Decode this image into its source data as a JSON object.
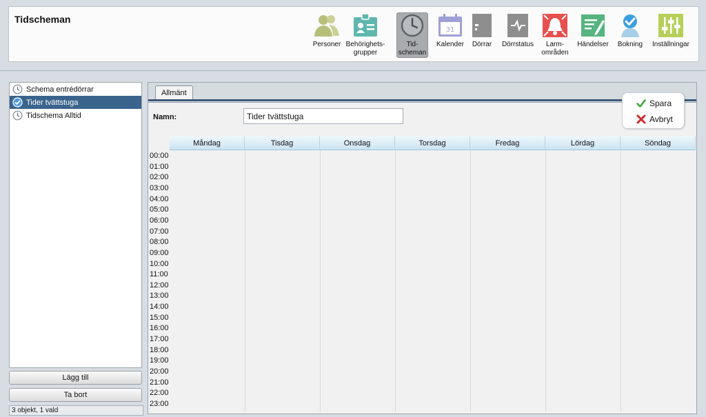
{
  "header": {
    "title": "Tidscheman",
    "tools": [
      {
        "name": "Personer",
        "lines": [
          "Personer",
          ""
        ],
        "icon": "persons-icon"
      },
      {
        "name": "Behörighetsgrupper",
        "lines": [
          "Behörighets-",
          "grupper"
        ],
        "icon": "id-card-icon"
      },
      {
        "name": "Tidscheman",
        "lines": [
          "Tid-",
          "scheman"
        ],
        "icon": "clock-icon",
        "active": true
      },
      {
        "name": "Kalender",
        "lines": [
          "Kalender",
          ""
        ],
        "icon": "calendar-icon"
      },
      {
        "name": "Dörrar",
        "lines": [
          "Dörrar",
          ""
        ],
        "icon": "door-icon"
      },
      {
        "name": "Dörrstatus",
        "lines": [
          "Dörrstatus",
          ""
        ],
        "icon": "door-status-icon"
      },
      {
        "name": "Larmområden",
        "lines": [
          "Larm-",
          "områden"
        ],
        "icon": "alarm-icon"
      },
      {
        "name": "Händelser",
        "lines": [
          "Händelser",
          ""
        ],
        "icon": "events-icon"
      },
      {
        "name": "Bokning",
        "lines": [
          "Bokning",
          ""
        ],
        "icon": "booking-icon"
      },
      {
        "name": "Inställningar",
        "lines": [
          "Inställningar",
          ""
        ],
        "icon": "settings-sliders-icon"
      }
    ]
  },
  "sidebar": {
    "items": [
      {
        "label": "Schema entrédörrar",
        "selected": false
      },
      {
        "label": "Tider tvättstuga",
        "selected": true
      },
      {
        "label": "Tidschema Alltid",
        "selected": false
      }
    ],
    "add_label": "Lägg till",
    "remove_label": "Ta bort",
    "status": "3 objekt, 1 vald"
  },
  "form": {
    "tab_label": "Allmänt",
    "name_label": "Namn:",
    "name_value": "Tider tvättstuga",
    "save_label": "Spara",
    "cancel_label": "Avbryt"
  },
  "schedule": {
    "days": [
      "Måndag",
      "Tisdag",
      "Onsdag",
      "Torsdag",
      "Fredag",
      "Lördag",
      "Söndag"
    ],
    "hours": [
      "00:00",
      "01:00",
      "02:00",
      "03:00",
      "04:00",
      "05:00",
      "06:00",
      "07:00",
      "08:00",
      "09:00",
      "10:00",
      "11:00",
      "12:00",
      "13:00",
      "14:00",
      "15:00",
      "16:00",
      "17:00",
      "18:00",
      "19:00",
      "20:00",
      "21:00",
      "22:00",
      "23:00"
    ]
  },
  "colors": {
    "selection": "#3a648c",
    "persons": "#b7c07a",
    "idcard": "#5fb7ae",
    "calendar": "#9f9fd6",
    "door": "#8e8e8e",
    "alarm": "#e8504d",
    "events": "#55b47f",
    "booking": "#3a9ee0",
    "settings": "#b6cf58"
  }
}
